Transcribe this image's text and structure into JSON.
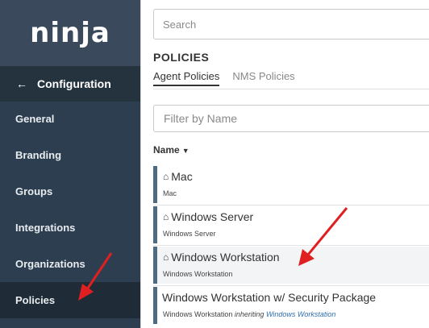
{
  "sidebar": {
    "logo": "ninja",
    "config_label": "Configuration",
    "items": [
      {
        "label": "General"
      },
      {
        "label": "Branding"
      },
      {
        "label": "Groups"
      },
      {
        "label": "Integrations"
      },
      {
        "label": "Organizations"
      },
      {
        "label": "Policies"
      }
    ]
  },
  "main": {
    "search_placeholder": "Search",
    "title": "POLICIES",
    "tabs": [
      {
        "label": "Agent Policies"
      },
      {
        "label": "NMS Policies"
      }
    ],
    "filter_placeholder": "Filter by Name",
    "sort_label": "Name",
    "policies": [
      {
        "name": "Mac",
        "subtitle": "Mac"
      },
      {
        "name": "Windows Server",
        "subtitle": "Windows Server"
      },
      {
        "name": "Windows Workstation",
        "subtitle": "Windows Workstation"
      },
      {
        "name": "Windows Workstation w/ Security Package",
        "subtitle": "Windows Workstation",
        "inherit_text": "inheriting",
        "inherit_link": "Windows Workstation"
      }
    ]
  },
  "colors": {
    "sidebar_bg": "#2c3e50",
    "accent_bar": "#4d6c84",
    "annotation_arrow": "#e02020",
    "link": "#2f6fb0"
  }
}
